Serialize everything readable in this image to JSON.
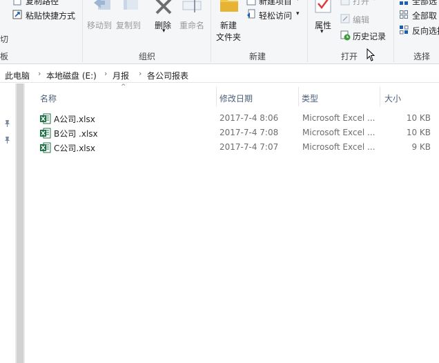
{
  "ribbon": {
    "clipboard": {
      "copy_path": "复制路径",
      "paste_shortcut": "粘贴快捷方式",
      "cut_partial": "切",
      "group_partial": "板"
    },
    "organize": {
      "group": "组织",
      "move_to": "移动到",
      "copy_to": "复制到",
      "delete": "删除",
      "rename": "重命名"
    },
    "new": {
      "group": "新建",
      "new_folder_line1": "新建",
      "new_folder_line2": "文件夹",
      "new_item": "新建项目",
      "easy_access": "轻松访问"
    },
    "open": {
      "group": "打开",
      "properties": "属性",
      "open": "打开",
      "edit": "编辑",
      "history": "历史记录"
    },
    "select": {
      "group": "选择",
      "select_all": "全部选",
      "select_none": "全部取",
      "invert": "反向选择"
    }
  },
  "breadcrumb": [
    "此电脑",
    "本地磁盘 (E:)",
    "月报",
    "各公司报表"
  ],
  "columns": {
    "name": "名称",
    "date": "修改日期",
    "type": "类型",
    "size": "大小"
  },
  "files": [
    {
      "name": "A公司.xlsx",
      "date": "2017-7-4 8:06",
      "type": "Microsoft Excel ...",
      "size": "10 KB"
    },
    {
      "name": "B公司 .xlsx",
      "date": "2017-7-4 7:08",
      "type": "Microsoft Excel ...",
      "size": "10 KB"
    },
    {
      "name": "C公司.xlsx",
      "date": "2017-7-4 7:07",
      "type": "Microsoft Excel ...",
      "size": "9 KB"
    }
  ],
  "colors": {
    "excel_green": "#1e7145",
    "header_text": "#4c607a",
    "red_check": "#e03a3a"
  }
}
